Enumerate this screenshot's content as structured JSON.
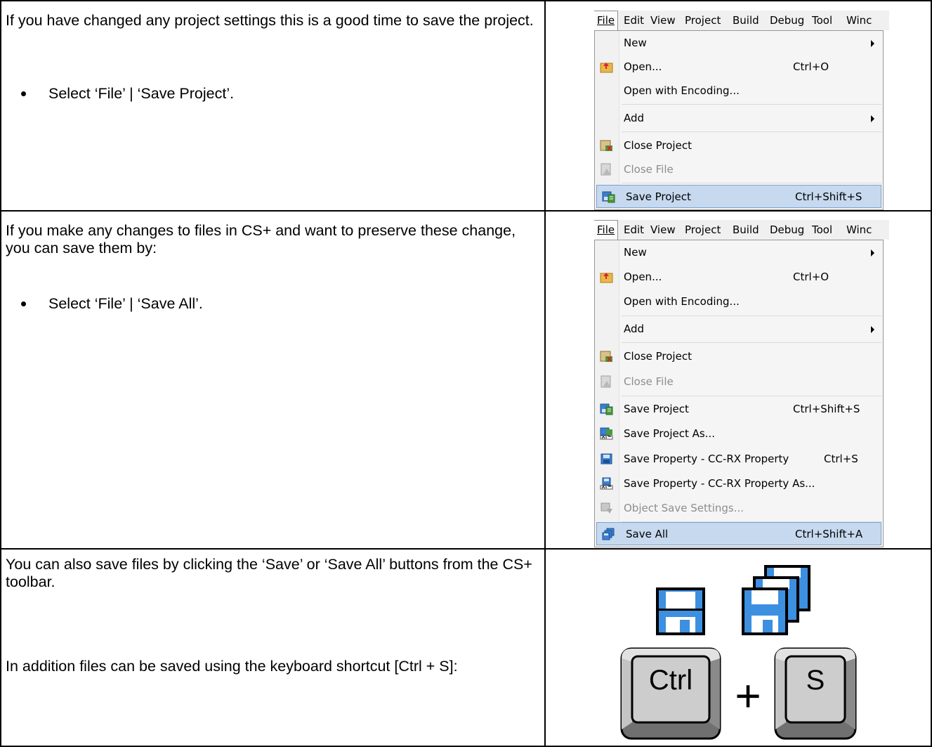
{
  "rows": [
    {
      "paragraph": "If you have changed any project settings this is a good time to save the project.",
      "bullet": "Select ‘File’ | ‘Save Project’."
    },
    {
      "paragraph": "If you make any changes to files in CS+ and want to preserve these change, you can save them by:",
      "bullet": "Select ‘File’ | ‘Save All’."
    },
    {
      "paragraph_1": "You can also save files by clicking the ‘Save’ or ‘Save All’ buttons from the CS+ toolbar.",
      "paragraph_2": "In addition files can be saved using the keyboard shortcut [Ctrl + S]:"
    }
  ],
  "menubar": {
    "file": "File",
    "edit": "Edit",
    "view": "View",
    "project": "Project",
    "build": "Build",
    "debug": "Debug",
    "tool": "Tool",
    "window": "Winc"
  },
  "menu1": {
    "new": "New",
    "open": "Open...",
    "open_shortcut": "Ctrl+O",
    "open_encoding": "Open with Encoding...",
    "add": "Add",
    "close_project": "Close Project",
    "close_file": "Close File",
    "save_project": "Save Project",
    "save_project_shortcut": "Ctrl+Shift+S"
  },
  "menu2": {
    "new": "New",
    "open": "Open...",
    "open_shortcut": "Ctrl+O",
    "open_encoding": "Open with Encoding...",
    "add": "Add",
    "close_project": "Close Project",
    "close_file": "Close File",
    "save_project": "Save Project",
    "save_project_shortcut": "Ctrl+Shift+S",
    "save_project_as": "Save Project As...",
    "save_property": "Save Property - CC-RX Property",
    "save_property_shortcut": "Ctrl+S",
    "save_property_as": "Save Property - CC-RX Property As...",
    "object_save_settings": "Object Save Settings...",
    "save_all": "Save All",
    "save_all_shortcut": "Ctrl+Shift+A"
  },
  "keys": {
    "ctrl": "Ctrl",
    "plus": "+",
    "s": "S"
  },
  "colors": {
    "highlight": "#c6d9ef",
    "highlight_border": "#7da2ce",
    "floppy_blue": "#3d8fe0"
  }
}
